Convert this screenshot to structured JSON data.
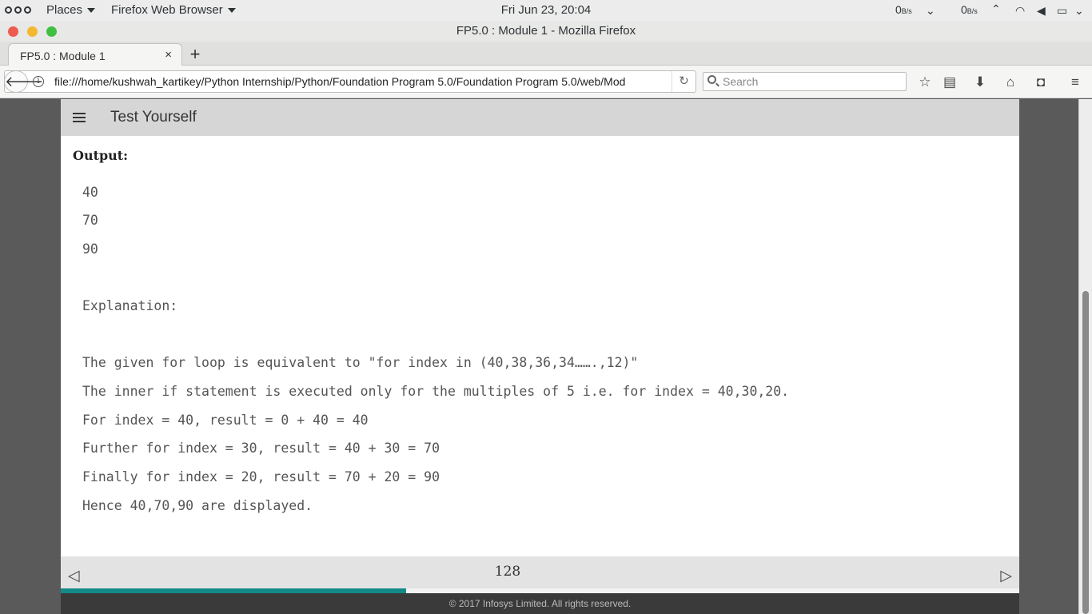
{
  "topbar": {
    "places_label": "Places",
    "app_label": "Firefox Web Browser",
    "clock": "Fri Jun 23, 20:04",
    "net_down": "0",
    "net_down_unit": "B/s",
    "net_up": "0",
    "net_up_unit": "B/s"
  },
  "window": {
    "title": "FP5.0 : Module 1 - Mozilla Firefox"
  },
  "tab": {
    "label": "FP5.0 : Module 1",
    "close": "×",
    "new": "+"
  },
  "nav": {
    "url": "file:///home/kushwah_kartikey/Python Internship/Python/Foundation Program 5.0/Foundation Program 5.0/web/Mod",
    "search_placeholder": "Search"
  },
  "app": {
    "title": "Test Yourself"
  },
  "content": {
    "output_label": "Output:",
    "lines": [
      "40",
      "70",
      "90",
      "Explanation:",
      "The given for loop is equivalent to \"for index in (40,38,36,34…….,12)\"",
      "The inner if statement is executed only for the multiples of 5 i.e. for index = 40,30,20.",
      "For index = 40, result = 0 + 40 = 40",
      "Further for index = 30, result = 40 + 30 = 70",
      "Finally for index = 20, result = 70 + 20 = 90",
      "Hence 40,70,90 are displayed."
    ]
  },
  "footer": {
    "page_number": "128",
    "progress": 0.36,
    "progress_color": "#128a88",
    "copyright": "© 2017 Infosys Limited. All rights reserved."
  }
}
